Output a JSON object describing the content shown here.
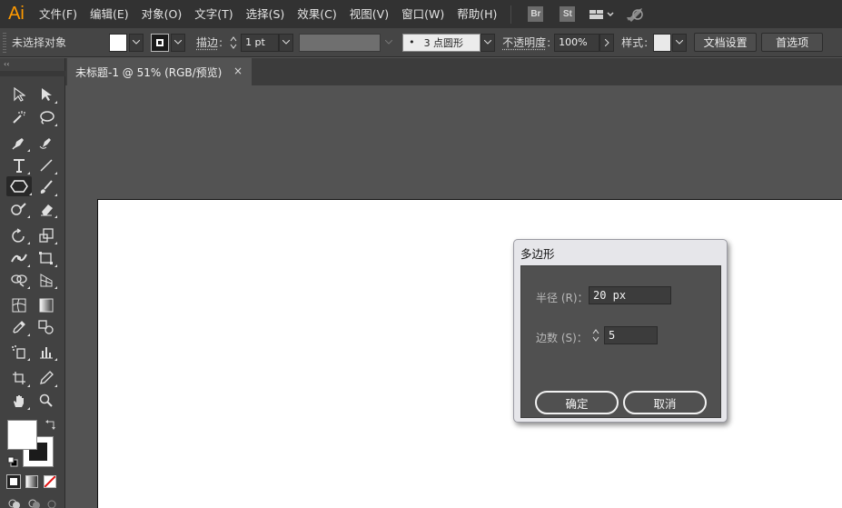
{
  "app": {
    "logo": "Ai"
  },
  "menu": [
    "文件(F)",
    "编辑(E)",
    "对象(O)",
    "文字(T)",
    "选择(S)",
    "效果(C)",
    "视图(V)",
    "窗口(W)",
    "帮助(H)"
  ],
  "menubar_badges": {
    "bridge": "Br",
    "stock": "St"
  },
  "control_bar": {
    "selection_status": "未选择对象",
    "stroke_label": "描边",
    "stroke_weight": "1 pt",
    "brush_label": "3 点圆形",
    "brush_dot": "•",
    "opacity_label": "不透明度",
    "opacity_value": "100%",
    "style_label": "样式",
    "doc_setup_button": "文档设置",
    "preferences_button": "首选项"
  },
  "panel_collapse": "‹‹",
  "document_tab": {
    "title": "未标题-1 @ 51% (RGB/预览)",
    "close": "×"
  },
  "polygon_dialog": {
    "title": "多边形",
    "radius_label": "半径 (R)：",
    "radius_value": "20 px",
    "sides_label": "边数 (S)：",
    "sides_value": "5",
    "ok_button": "确定",
    "cancel_button": "取消"
  },
  "colors": {
    "menubar_bg": "#323232",
    "controlbar_bg": "#454545",
    "pasteboard": "#535353",
    "artboard": "#ffffff",
    "dialog_frame": "#e6e6ea",
    "dialog_body": "#505050",
    "logo": "#ff9a00"
  },
  "tools": [
    "selection-tool-icon",
    "direct-selection-tool-icon",
    "magic-wand-tool-icon",
    "lasso-tool-icon",
    "pen-tool-icon",
    "curvature-tool-icon",
    "type-tool-icon",
    "line-segment-tool-icon",
    "polygon-tool-icon",
    "paintbrush-tool-icon",
    "shaper-tool-icon",
    "eraser-tool-icon",
    "rotate-tool-icon",
    "scale-tool-icon",
    "width-tool-icon",
    "free-transform-tool-icon",
    "shape-builder-tool-icon",
    "perspective-grid-tool-icon",
    "mesh-tool-icon",
    "gradient-tool-icon",
    "eyedropper-tool-icon",
    "blend-tool-icon",
    "symbol-sprayer-tool-icon",
    "column-graph-tool-icon",
    "artboard-tool-icon",
    "slice-tool-icon",
    "hand-tool-icon",
    "zoom-tool-icon"
  ]
}
